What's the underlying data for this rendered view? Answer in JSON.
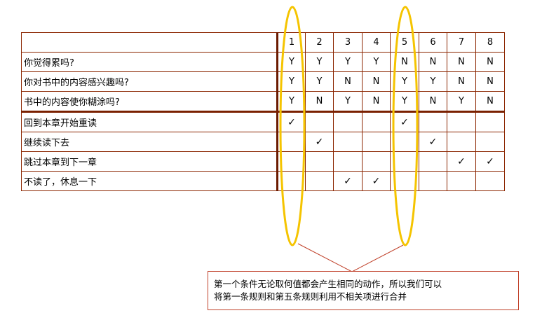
{
  "columns": [
    "1",
    "2",
    "3",
    "4",
    "5",
    "6",
    "7",
    "8"
  ],
  "conditions": [
    {
      "label": "你觉得累吗?",
      "values": [
        "Y",
        "Y",
        "Y",
        "Y",
        "N",
        "N",
        "N",
        "N"
      ]
    },
    {
      "label": "你对书中的内容感兴趣吗?",
      "values": [
        "Y",
        "Y",
        "N",
        "N",
        "Y",
        "Y",
        "N",
        "N"
      ]
    },
    {
      "label": "书中的内容使你糊涂吗?",
      "values": [
        "Y",
        "N",
        "Y",
        "N",
        "Y",
        "N",
        "Y",
        "N"
      ]
    }
  ],
  "actions": [
    {
      "label": "回到本章开始重读",
      "checks": [
        true,
        false,
        false,
        false,
        true,
        false,
        false,
        false
      ]
    },
    {
      "label": "继续读下去",
      "checks": [
        false,
        true,
        false,
        false,
        false,
        true,
        false,
        false
      ]
    },
    {
      "label": "跳过本章到下一章",
      "checks": [
        false,
        false,
        false,
        false,
        false,
        false,
        true,
        true
      ]
    },
    {
      "label": "不读了，休息一下",
      "checks": [
        false,
        false,
        true,
        true,
        false,
        false,
        false,
        false
      ]
    }
  ],
  "check_mark": "✓",
  "annotation": {
    "line1": "第一个条件无论取何值都会产生相同的动作，所以我们可以",
    "line2": "将第一条规则和第五条规则利用不相关项进行合并"
  },
  "colors": {
    "table_border": "#8b2500",
    "highlight_ellipse": "#f5c400",
    "callout_border": "#c0412a"
  }
}
